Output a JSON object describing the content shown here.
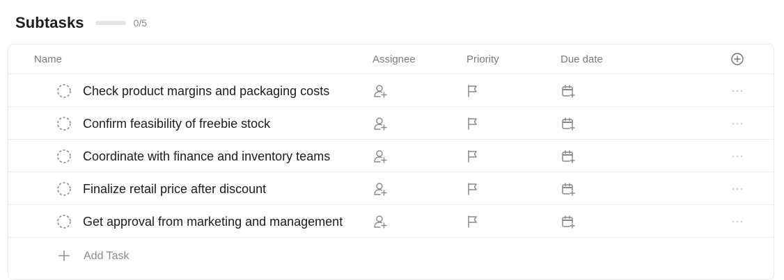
{
  "header": {
    "title": "Subtasks",
    "progress_fraction": 0,
    "count": "0/5"
  },
  "columns": {
    "name": "Name",
    "assignee": "Assignee",
    "priority": "Priority",
    "due_date": "Due date"
  },
  "tasks": [
    {
      "name": "Check product margins and packaging costs"
    },
    {
      "name": "Confirm feasibility of freebie stock"
    },
    {
      "name": "Coordinate with finance and inventory teams"
    },
    {
      "name": "Finalize retail price after discount"
    },
    {
      "name": "Get approval from marketing and management"
    }
  ],
  "add_task": {
    "label": "Add Task"
  },
  "icons": {
    "status": "dashed-circle-icon",
    "assignee": "add-person-icon",
    "priority": "flag-icon",
    "due_date": "calendar-add-icon",
    "more": "more-dots-icon",
    "add_column": "plus-circle-icon",
    "add_task": "plus-icon"
  },
  "colors": {
    "progress_track": "#e4e4e4",
    "text_primary": "#1c1c1c",
    "text_muted": "#7c7c7c",
    "icon_gray": "#8a8a8a",
    "border": "#ececec"
  }
}
